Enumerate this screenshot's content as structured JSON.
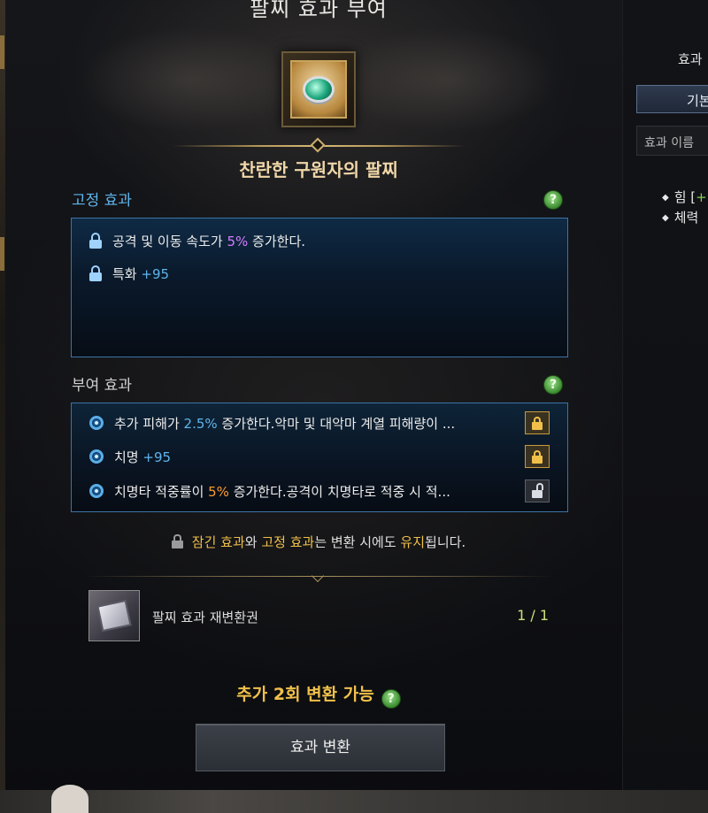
{
  "window": {
    "title": "팔찌 효과 부여",
    "item_name": "찬란한 구원자의 팔찌"
  },
  "fixed_effects": {
    "label": "고정 효과",
    "help": "?",
    "rows": [
      {
        "icon": "lock-icon",
        "pre": "공격 및 이동 속도가 ",
        "highlight": "5%",
        "post": " 증가한다."
      },
      {
        "icon": "lock-icon",
        "pre": "특화 ",
        "highlight": "+95",
        "post": ""
      }
    ]
  },
  "granted_effects": {
    "label": "부여 효과",
    "help": "?",
    "rows": [
      {
        "icon": "swirl-icon",
        "pre": "추가 피해가 ",
        "highlight": "2.5%",
        "post": " 증가한다.악마 및 대악마 계열 피해량이 ...",
        "locked": true
      },
      {
        "icon": "swirl-icon",
        "pre": "치명 ",
        "highlight": "+95",
        "post": "",
        "locked": true
      },
      {
        "icon": "swirl-icon",
        "pre": "치명타 적중률이 ",
        "highlight": "5%",
        "post": " 증가한다.공격이 치명타로 적중 시 적...",
        "locked": false
      }
    ]
  },
  "note": {
    "a": "잠긴 효과",
    "b": "와 ",
    "c": "고정 효과",
    "d": "는 변환 시에도 ",
    "e": "유지",
    "f": "됩니다."
  },
  "ticket": {
    "name": "팔찌 효과 재변환권",
    "count": "1 / 1"
  },
  "remaining_text": "추가 2회 변환 가능",
  "remaining_help": "?",
  "convert_button": "효과 변환",
  "side_panel": {
    "title": "효과",
    "tab": "기본",
    "search_placeholder": "효과 이름",
    "stats": [
      {
        "name": "힘 [",
        "plus": "+"
      },
      {
        "name": "체력",
        "plus": ""
      }
    ]
  },
  "colors": {
    "accent_blue": "#5fb5ec",
    "gold": "#f0c04a",
    "purple": "#d47cff",
    "orange": "#ff9a2e",
    "green": "#c9e07a"
  }
}
